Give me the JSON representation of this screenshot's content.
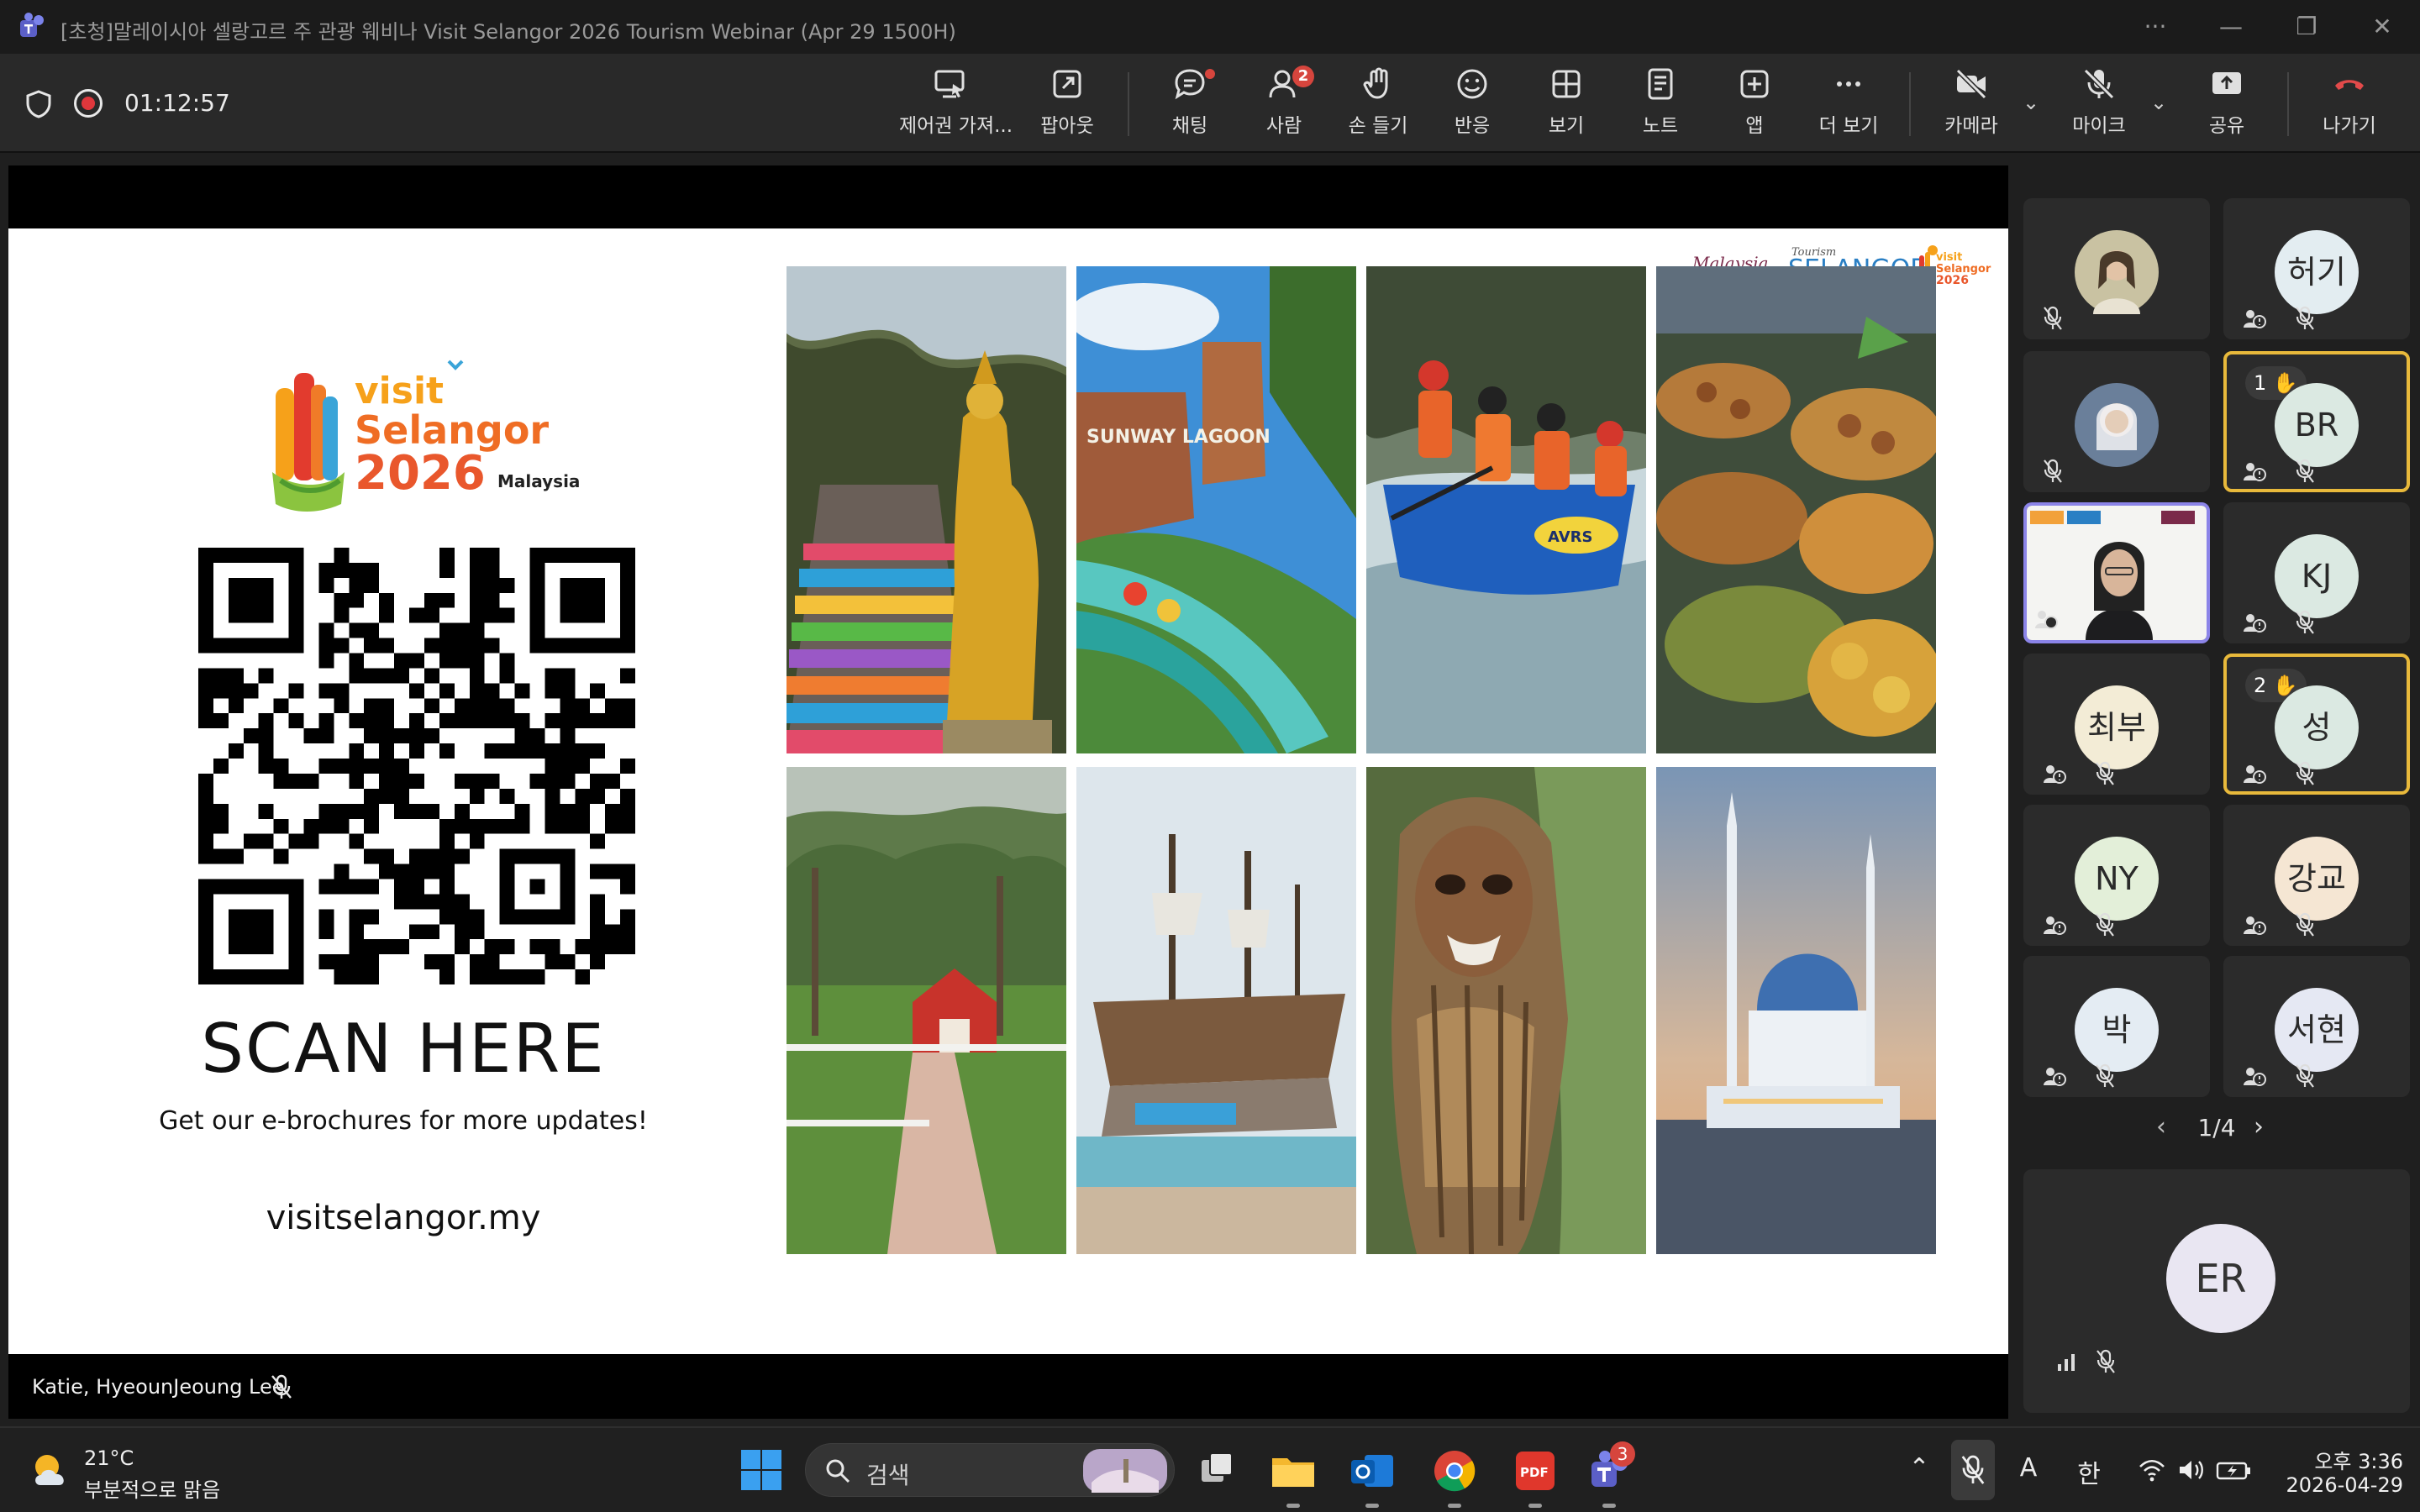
{
  "window": {
    "title": "[초청]말레이시아 셀랑고르 주 관광 웨비나 Visit Selangor 2026 Tourism Webinar (Apr 29 1500H)"
  },
  "toolbar": {
    "timer": "01:12:57",
    "buttons": [
      {
        "label": "제어권 가져...",
        "icon": "take-control-icon"
      },
      {
        "label": "팝아웃",
        "icon": "popout-icon"
      },
      {
        "label": "채팅",
        "icon": "chat-icon"
      },
      {
        "label": "사람",
        "icon": "people-icon",
        "badge": "2"
      },
      {
        "label": "손 들기",
        "icon": "raise-hand-icon"
      },
      {
        "label": "반응",
        "icon": "react-icon"
      },
      {
        "label": "보기",
        "icon": "view-icon"
      },
      {
        "label": "노트",
        "icon": "notes-icon"
      },
      {
        "label": "앱",
        "icon": "apps-icon"
      },
      {
        "label": "더 보기",
        "icon": "more-icon"
      },
      {
        "label": "카메라",
        "icon": "camera-off-icon"
      },
      {
        "label": "마이크",
        "icon": "mic-off-icon"
      },
      {
        "label": "공유",
        "icon": "share-icon"
      },
      {
        "label": "나가기",
        "icon": "leave-icon"
      }
    ],
    "accent": "#d6453d"
  },
  "slide": {
    "logo_line1": "visit",
    "logo_line2": "Selangor",
    "logo_line3": "2026",
    "logo_line4": "Malaysia",
    "scan_here": "SCAN HERE",
    "subtitle": "Get our e-brochures for more updates!",
    "url": "visitselangor.my",
    "top_logo_malaysia": "Malaysia",
    "top_logo_tourism": "Tourism",
    "top_logo_selangor": "SELANGOR",
    "top_logo_visit": "visit",
    "top_logo_selangor2": "Selangor",
    "top_logo_2026": "2026",
    "photo_sign": "SUNWAY LAGOON",
    "raft_label": "AVRS"
  },
  "presenter": {
    "name": "Katie, HyeounJeoung Lee"
  },
  "participants": {
    "tiles": [
      {
        "initials": "",
        "type": "photo"
      },
      {
        "initials": "허기",
        "color": "#e3edf1"
      },
      {
        "initials": "",
        "type": "photo"
      },
      {
        "initials": "BR",
        "color": "#dbe9e2",
        "hand": "1"
      },
      {
        "initials": "",
        "type": "video"
      },
      {
        "initials": "KJ",
        "color": "#dbe9e2"
      },
      {
        "initials": "최부",
        "color": "#f3ecd6"
      },
      {
        "initials": "성",
        "color": "#dbe9e2",
        "hand": "2"
      },
      {
        "initials": "NY",
        "color": "#e3efd9"
      },
      {
        "initials": "강교",
        "color": "#f5e6d3"
      },
      {
        "initials": "박",
        "color": "#e4ecf3"
      },
      {
        "initials": "서현",
        "color": "#e5e8f3"
      }
    ],
    "pager": "1/4",
    "self_initials": "ER",
    "highlight_color": "#e8b93b",
    "active_color": "#8b84e8"
  },
  "taskbar": {
    "weather_temp": "21°C",
    "weather_desc": "부분적으로 맑음",
    "search_text": "검색",
    "teams_badge": "3",
    "ime_a": "A",
    "ime_lang": "한",
    "clock_time": "오후 3:36",
    "clock_date": "2026-04-29",
    "pdf_label": "PDF"
  }
}
